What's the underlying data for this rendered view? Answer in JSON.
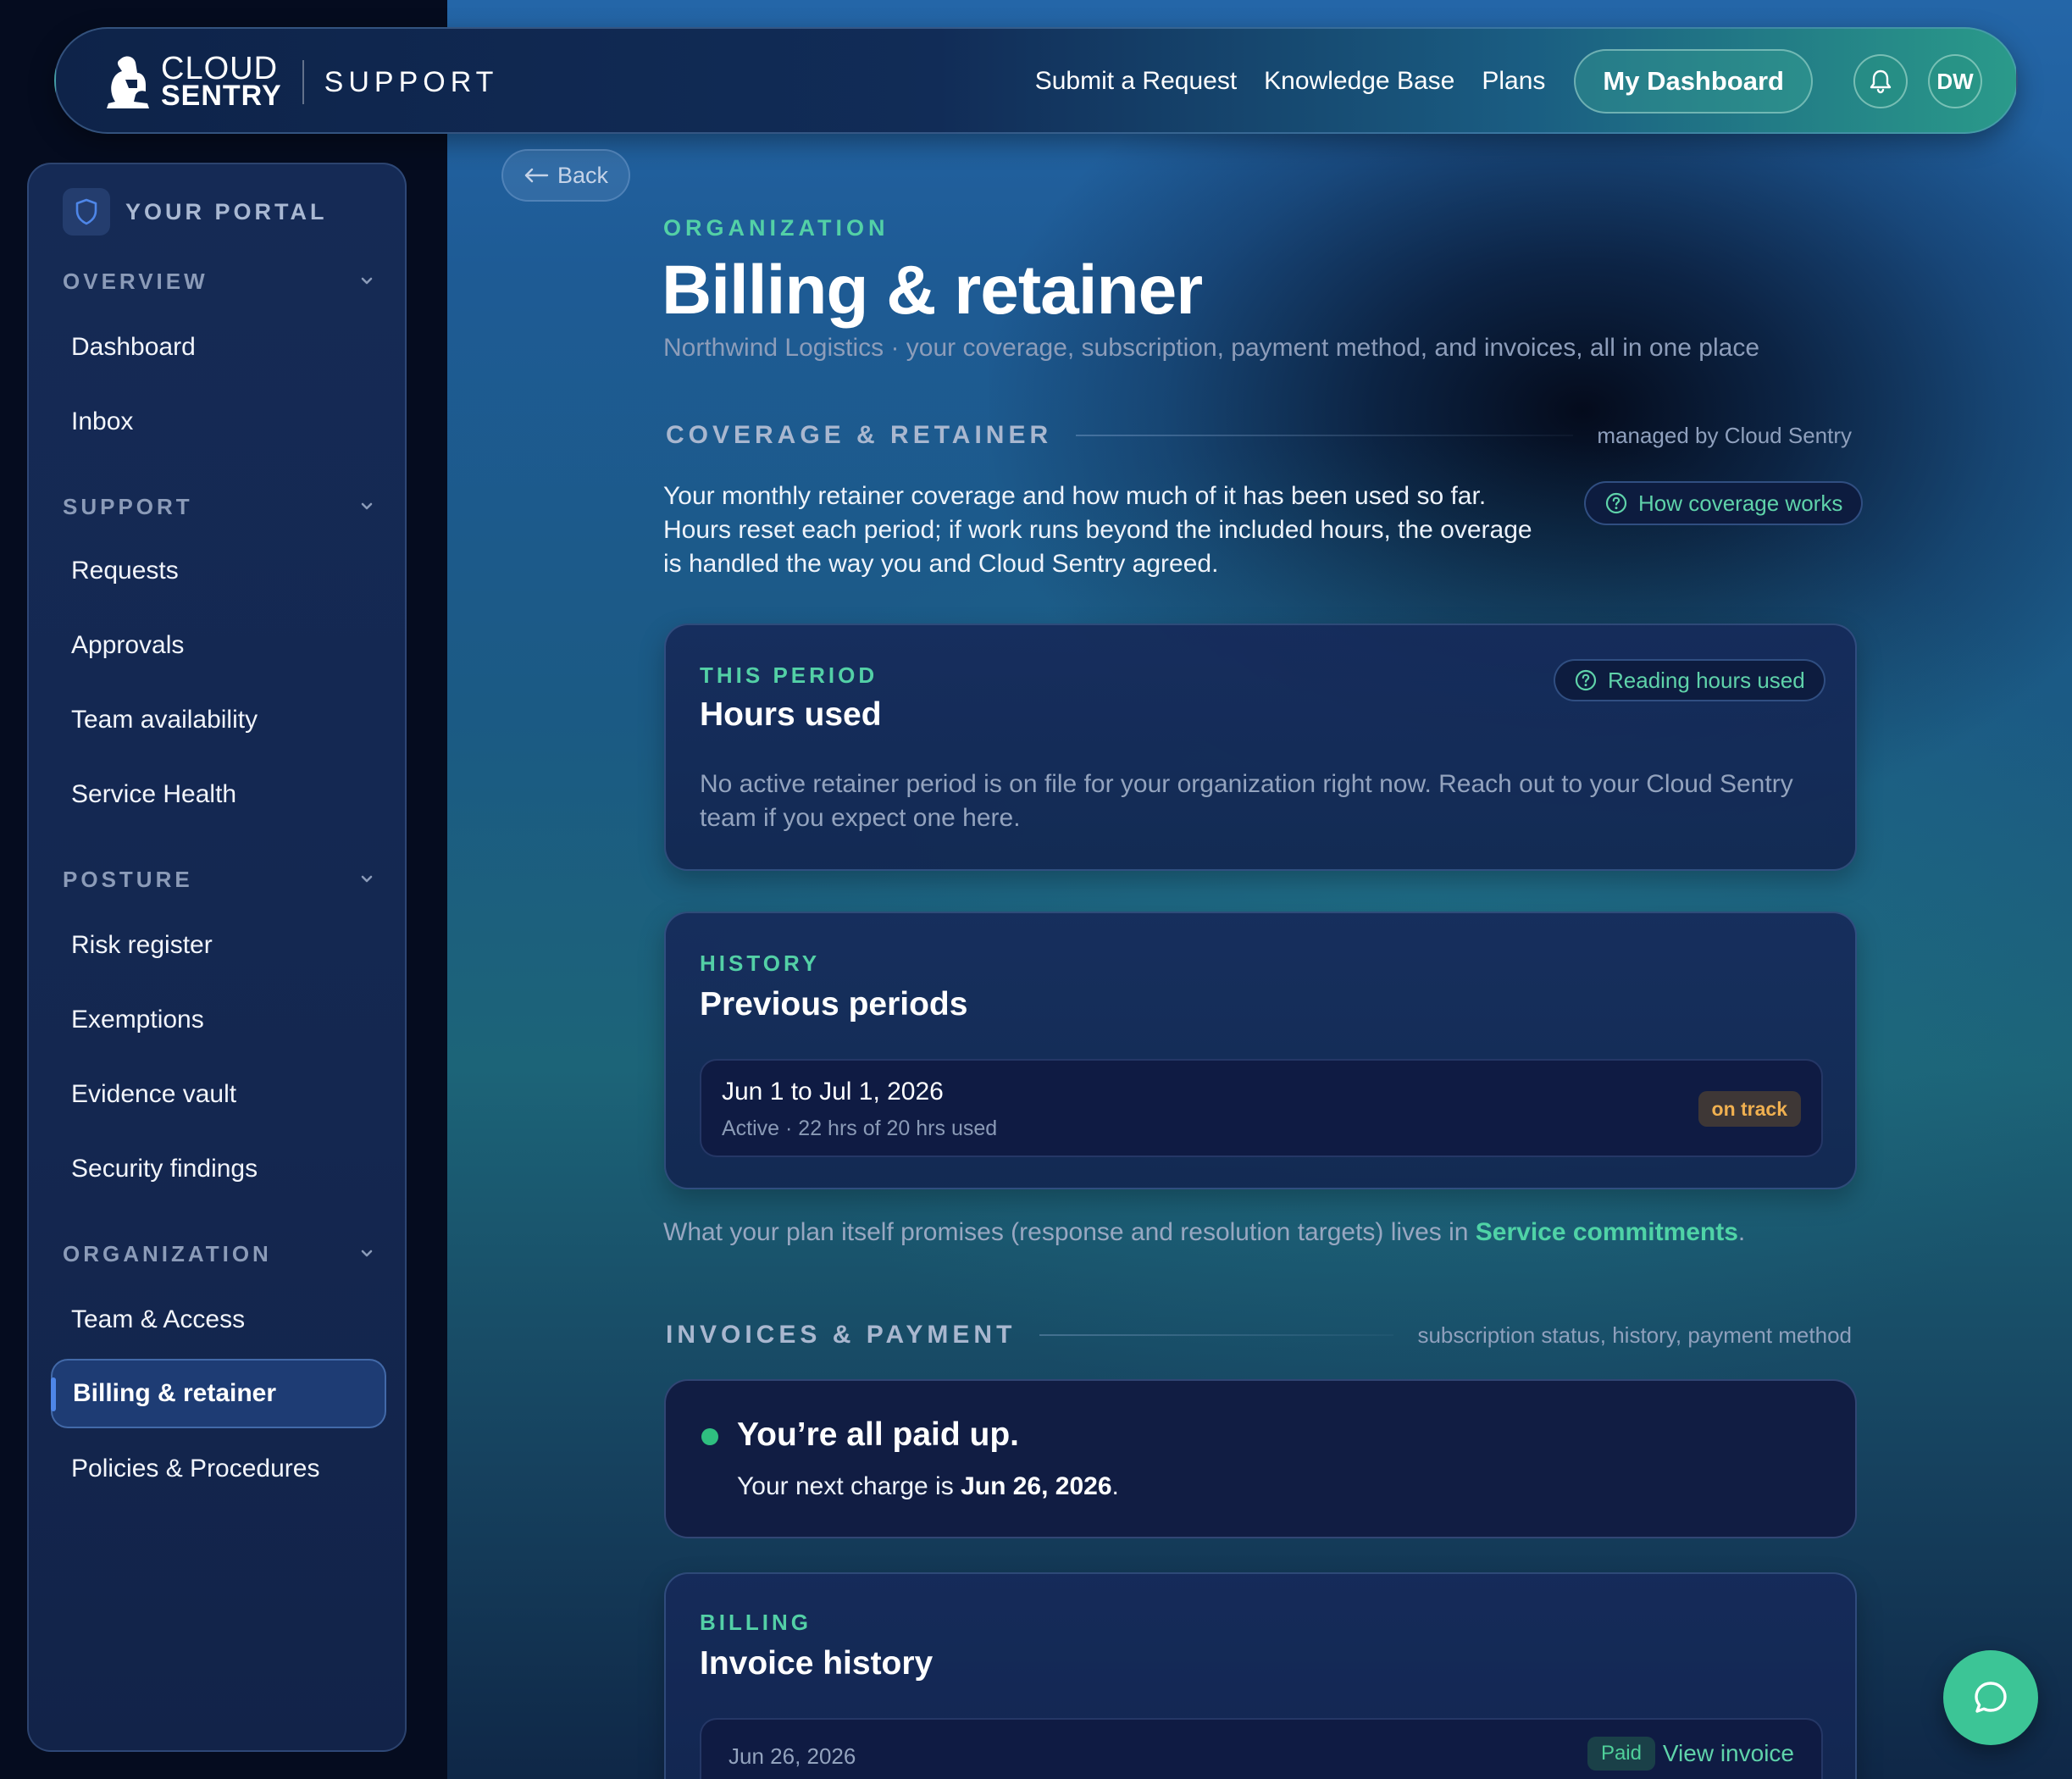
{
  "brand": {
    "line1": "CLOUD",
    "line2": "SENTRY",
    "product": "SUPPORT"
  },
  "topnav": {
    "links": [
      "Submit a Request",
      "Knowledge Base",
      "Plans"
    ],
    "dashboard_button": "My Dashboard",
    "avatar_initials": "DW",
    "icons": [
      "bell-icon"
    ]
  },
  "sidebar": {
    "portal_label": "YOUR PORTAL",
    "sections": [
      {
        "title": "OVERVIEW",
        "items": [
          "Dashboard",
          "Inbox"
        ]
      },
      {
        "title": "SUPPORT",
        "items": [
          "Requests",
          "Approvals",
          "Team availability",
          "Service Health"
        ]
      },
      {
        "title": "POSTURE",
        "items": [
          "Risk register",
          "Exemptions",
          "Evidence vault",
          "Security findings"
        ]
      },
      {
        "title": "ORGANIZATION",
        "items": [
          "Team & Access",
          "Billing & retainer",
          "Policies & Procedures"
        ]
      }
    ],
    "active_item": "Billing & retainer"
  },
  "main": {
    "back_label": "Back",
    "eyebrow": "ORGANIZATION",
    "title": "Billing & retainer",
    "subtitle": "Northwind Logistics · your coverage, subscription, payment method, and invoices, all in one place",
    "coverage": {
      "heading": "COVERAGE & RETAINER",
      "note": "managed by Cloud Sentry",
      "intro": "Your monthly retainer coverage and how much of it has been used so far. Hours reset each period; if work runs beyond the included hours, the overage is handled the way you and Cloud Sentry agreed.",
      "help_pill": "How coverage works"
    },
    "this_period": {
      "eyebrow": "THIS PERIOD",
      "title": "Hours used",
      "help_pill": "Reading hours used",
      "message": "No active retainer period is on file for your organization right now. Reach out to your Cloud Sentry team if you expect one here."
    },
    "history": {
      "eyebrow": "HISTORY",
      "title": "Previous periods",
      "rows": [
        {
          "range": "Jun 1 to Jul 1, 2026",
          "detail": "Active · 22 hrs of 20 hrs used",
          "status": "on track"
        }
      ]
    },
    "commitments": {
      "prefix": "What your plan itself promises (response and resolution targets) lives in ",
      "link": "Service commitments",
      "suffix": "."
    },
    "invoices": {
      "heading": "INVOICES & PAYMENT",
      "note": "subscription status, history, payment method",
      "paid_title": "You’re all paid up.",
      "paid_prefix": "Your next charge is ",
      "paid_date": "Jun 26, 2026",
      "paid_suffix": "."
    },
    "billing": {
      "eyebrow": "BILLING",
      "title": "Invoice history",
      "rows": [
        {
          "date": "Jun 26, 2026",
          "status": "Paid",
          "action": "View invoice"
        }
      ]
    }
  },
  "colors": {
    "accent": "#53d0a6",
    "warning": "#f0b050",
    "active_nav": "#4e86e8"
  }
}
